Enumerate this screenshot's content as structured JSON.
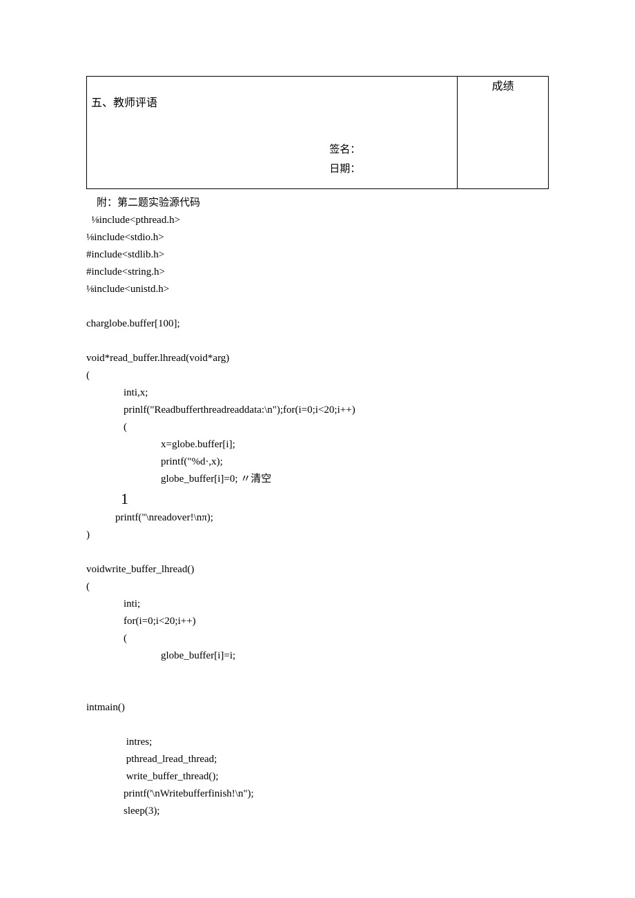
{
  "table": {
    "section": "五、教师评语",
    "signature_label": "签名：",
    "date_label": "日期：",
    "grade_label": "成绩"
  },
  "code": {
    "attach": "    附：第二题实验源代码",
    "inc1": "  ⅛include<pthread.h>",
    "inc2": "⅛include<stdio.h>",
    "inc3": "#include<stdlib.h>",
    "inc4": "#include<string.h>",
    "inc5": "⅛include<unistd.h>",
    "globe": "charglobe.buffer[100];",
    "rb_sig": "void*read_buffer.lhread(void*arg)",
    "lb": "(",
    "rb_l1": "inti,x;",
    "rb_l2": "prinlf(\"Readbufferthreadreaddata:\\n\");for(i=0;i<20;i++)",
    "rb_l3": "(",
    "rb_l4": "x=globe.buffer[i];",
    "rb_l5": "printf(\"%d·,x);",
    "rb_l6": "globe_buffer[i]=0; 〃清空",
    "one": "1",
    "rb_l7": "printf(\"\\nreadover!\\nπ);",
    "rb": ")",
    "wb_sig": "voidwrite_buffer_lhread()",
    "wb_l1": "inti;",
    "wb_l2": "for(i=0;i<20;i++)",
    "wb_l3": "(",
    "wb_l4": "globe_buffer[i]=i;",
    "main_sig": "intmain()",
    "m_l1": " intres;",
    "m_l2": " pthread_lread_thread;",
    "m_l3": " write_buffer_thread();",
    "m_l4": "printf('\\nWritebufferfinish!\\n\");",
    "m_l5": "sleep(3);"
  }
}
